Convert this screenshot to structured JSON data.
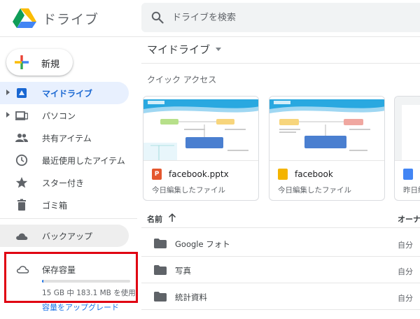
{
  "app": {
    "title": "ドライブ"
  },
  "search": {
    "placeholder": "ドライブを検索"
  },
  "sidebar": {
    "new_label": "新規",
    "items": [
      {
        "label": "マイドライブ",
        "icon": "my-drive-icon"
      },
      {
        "label": "パソコン",
        "icon": "computer-icon"
      },
      {
        "label": "共有アイテム",
        "icon": "shared-people-icon"
      },
      {
        "label": "最近使用したアイテム",
        "icon": "clock-icon"
      },
      {
        "label": "スター付き",
        "icon": "star-icon"
      },
      {
        "label": "ゴミ箱",
        "icon": "trash-icon"
      }
    ],
    "backup_label": "バックアップ",
    "storage": {
      "title": "保存容量",
      "usage_text": "15 GB 中 183.1 MB を使用",
      "used_fraction": 0.012,
      "upgrade_label": "容量をアップグレード",
      "highlight_color": "#e00012"
    }
  },
  "main": {
    "title": "マイドライブ",
    "quick_access_title": "クイック アクセス",
    "cards": [
      {
        "name": "facebook.pptx",
        "subtitle": "今日編集したファイル",
        "icon": "slides-file-icon",
        "icon_letter": "P",
        "icon_color": "#e4572e"
      },
      {
        "name": "facebook",
        "subtitle": "今日編集したファイル",
        "icon": "google-slides-icon",
        "icon_letter": "",
        "icon_color": "#f4b400"
      },
      {
        "name": "",
        "subtitle": "昨日編",
        "icon": "google-docs-icon",
        "icon_letter": "",
        "icon_color": "#4285f4"
      }
    ],
    "list": {
      "name_header": "名前",
      "owner_header": "オーナー",
      "rows": [
        {
          "name": "Google フォト",
          "owner": "自分"
        },
        {
          "name": "写真",
          "owner": "自分"
        },
        {
          "name": "統計資料",
          "owner": "自分"
        }
      ]
    }
  },
  "colors": {
    "accent": "#1a73e8",
    "active_bg": "#e8f0fe",
    "highlight_box": "#e00012"
  }
}
